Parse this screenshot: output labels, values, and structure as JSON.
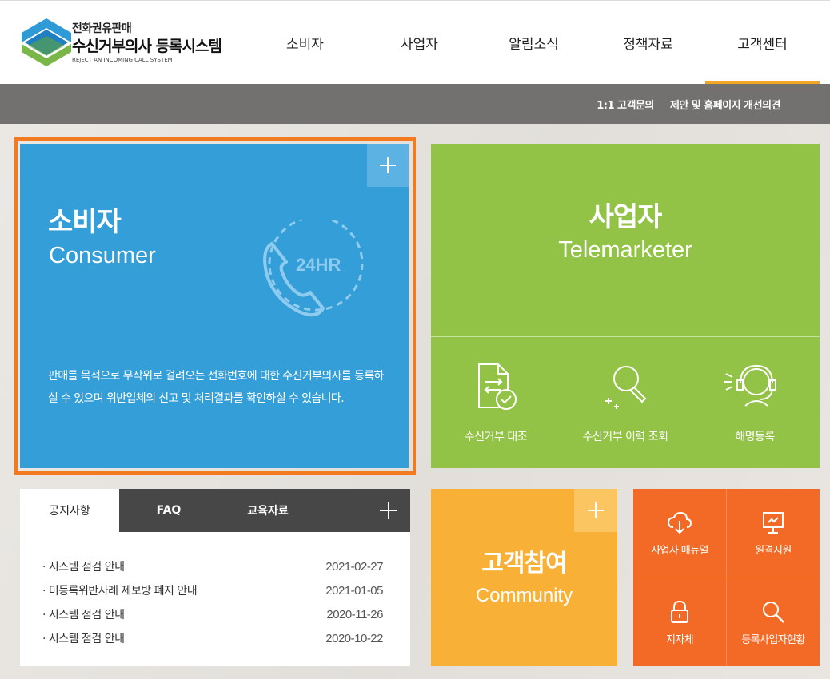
{
  "logo": {
    "line1": "전화권유판매",
    "line2": "수신거부의사 등록시스템",
    "line3": "REJECT AN INCOMING CALL SYSTEM"
  },
  "nav": [
    "소비자",
    "사업자",
    "알림소식",
    "정책자료",
    "고객센터"
  ],
  "subnav": [
    "1:1 고객문의",
    "제안 및 홈페이지 개선의견"
  ],
  "consumer": {
    "title": "소비자",
    "subtitle": "Consumer",
    "badge": "24HR",
    "description": "판매를 목적으로 무작위로 걸려오는 전화번호에 대한 수신거부의사를 등록하실 수 있으며 위반업체의 신고 및 처리결과를 확인하실 수 있습니다."
  },
  "telemarketer": {
    "title": "사업자",
    "subtitle": "Telemarketer",
    "items": [
      "수신거부 대조",
      "수신거부 이력 조회",
      "해명등록"
    ]
  },
  "board": {
    "tabs": [
      "공지사항",
      "FAQ",
      "교육자료"
    ],
    "rows": [
      {
        "title": "· 시스템 점검 안내",
        "date": "2021-02-27"
      },
      {
        "title": "· 미등록위반사례 제보방 폐지 안내",
        "date": "2021-01-05"
      },
      {
        "title": "· 시스템 점검 안내",
        "date": "2020-11-26"
      },
      {
        "title": "· 시스템 점검 안내",
        "date": "2020-10-22"
      }
    ]
  },
  "community": {
    "title": "고객참여",
    "subtitle": "Community"
  },
  "quick": [
    "사업자 매뉴얼",
    "원격지원",
    "지자체",
    "등록사업자현황"
  ],
  "colors": {
    "consumer": "#349ed8",
    "telemarketer": "#92c246",
    "community": "#f9b037",
    "quick": "#f26a26",
    "highlight": "#f47a1f",
    "nav_active": "#f2a623"
  }
}
